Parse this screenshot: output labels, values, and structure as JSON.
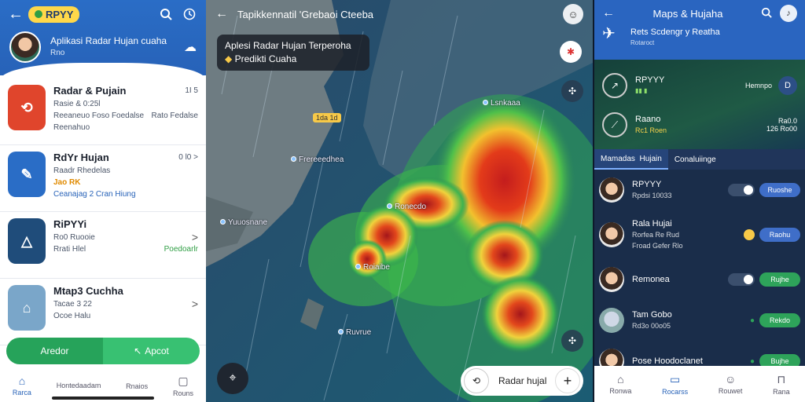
{
  "left": {
    "brand": "RPYY",
    "profile_title": "Aplikasi Radar Hujan cuaha",
    "profile_sub": "Rno",
    "apps": [
      {
        "name": "Radar & Pujain",
        "meta1": "Rasie & 0:25l",
        "meta2": "Reeaneuo Foso Foedalse",
        "meta3": "Reenahuo",
        "right1": "1I 5",
        "right2": "Rato Fedalse",
        "icon_color": "#e0452c"
      },
      {
        "name": "RdYr Hujan",
        "meta1": "Raadr Rhedelas",
        "meta2": "Jao RK",
        "meta3": "Ceanajag 2 Cran Hiung",
        "right1": "0 l0 >",
        "right2": "",
        "icon_color": "#2a6dc6"
      },
      {
        "name": "RiPYYi",
        "meta1": "Ro0 Ruooie",
        "meta2": "Rrati Hlel",
        "meta3": "",
        "right1": ">",
        "right2": "Poedoarlr",
        "icon_color": "#1f4c7a"
      },
      {
        "name": "Mtap3 Cuchha",
        "meta1": "Tacae 3 22",
        "meta2": "Ocoe Halu",
        "meta3": "",
        "right1": ">",
        "right2": "",
        "icon_color": "#7aa6c9"
      }
    ],
    "btn_left": "Aredor",
    "btn_right": "Apcot",
    "nav": [
      "Rarca",
      "Hontedaadam",
      "Rnaios",
      "Rouns"
    ]
  },
  "map": {
    "title": "Tapikkennatil 'Grebaoi Cteeba",
    "card_line1": "Aplesi Radar Hujan Terperoha",
    "card_line2": "Predikti Cuaha",
    "tag": "1da 1d",
    "cities": [
      "Lsnkaaa",
      "Frereeedhea",
      "Ronecdo",
      "Yuuosnane",
      "Roiaibe",
      "Ruvrue"
    ],
    "pill_label": "Radar hujal"
  },
  "right": {
    "title": "Maps & Hujaha",
    "sub1": "Rets Scdengr y Reatha",
    "sub2": "Rotaroct",
    "dash": [
      {
        "name": "RPYYY",
        "sub": "",
        "r1": "Hemnpo",
        "r2": ""
      },
      {
        "name": "Raano",
        "sub": "Rc1 Roen",
        "r1": "Ra0.0",
        "r2": "126 Ro00"
      }
    ],
    "tabs": [
      "Mamadas",
      "Hujain",
      "Conaluiinge"
    ],
    "items": [
      {
        "name": "RPYYY",
        "sub": "Rpdsi 10033",
        "btn": "Ruoshe",
        "btn_color": "blue"
      },
      {
        "name": "Rala Hujai",
        "sub": "Rorfea Re Rud",
        "extra": "Froad Gefer Rlo",
        "btn": "Raohu",
        "btn_color": "blue"
      },
      {
        "name": "Remonea",
        "sub": "",
        "btn": "Rujhe",
        "btn_color": "green"
      },
      {
        "name": "Tam Gobo",
        "sub": "Rd3o 00o05",
        "btn": "Rekdo",
        "btn_color": "green"
      },
      {
        "name": "Pose Hoodoclanet",
        "sub": "",
        "btn": "Bujhe",
        "btn_color": "green"
      }
    ],
    "nav": [
      "Ronwa",
      "Rocarss",
      "Rouwet",
      "Rana"
    ]
  }
}
